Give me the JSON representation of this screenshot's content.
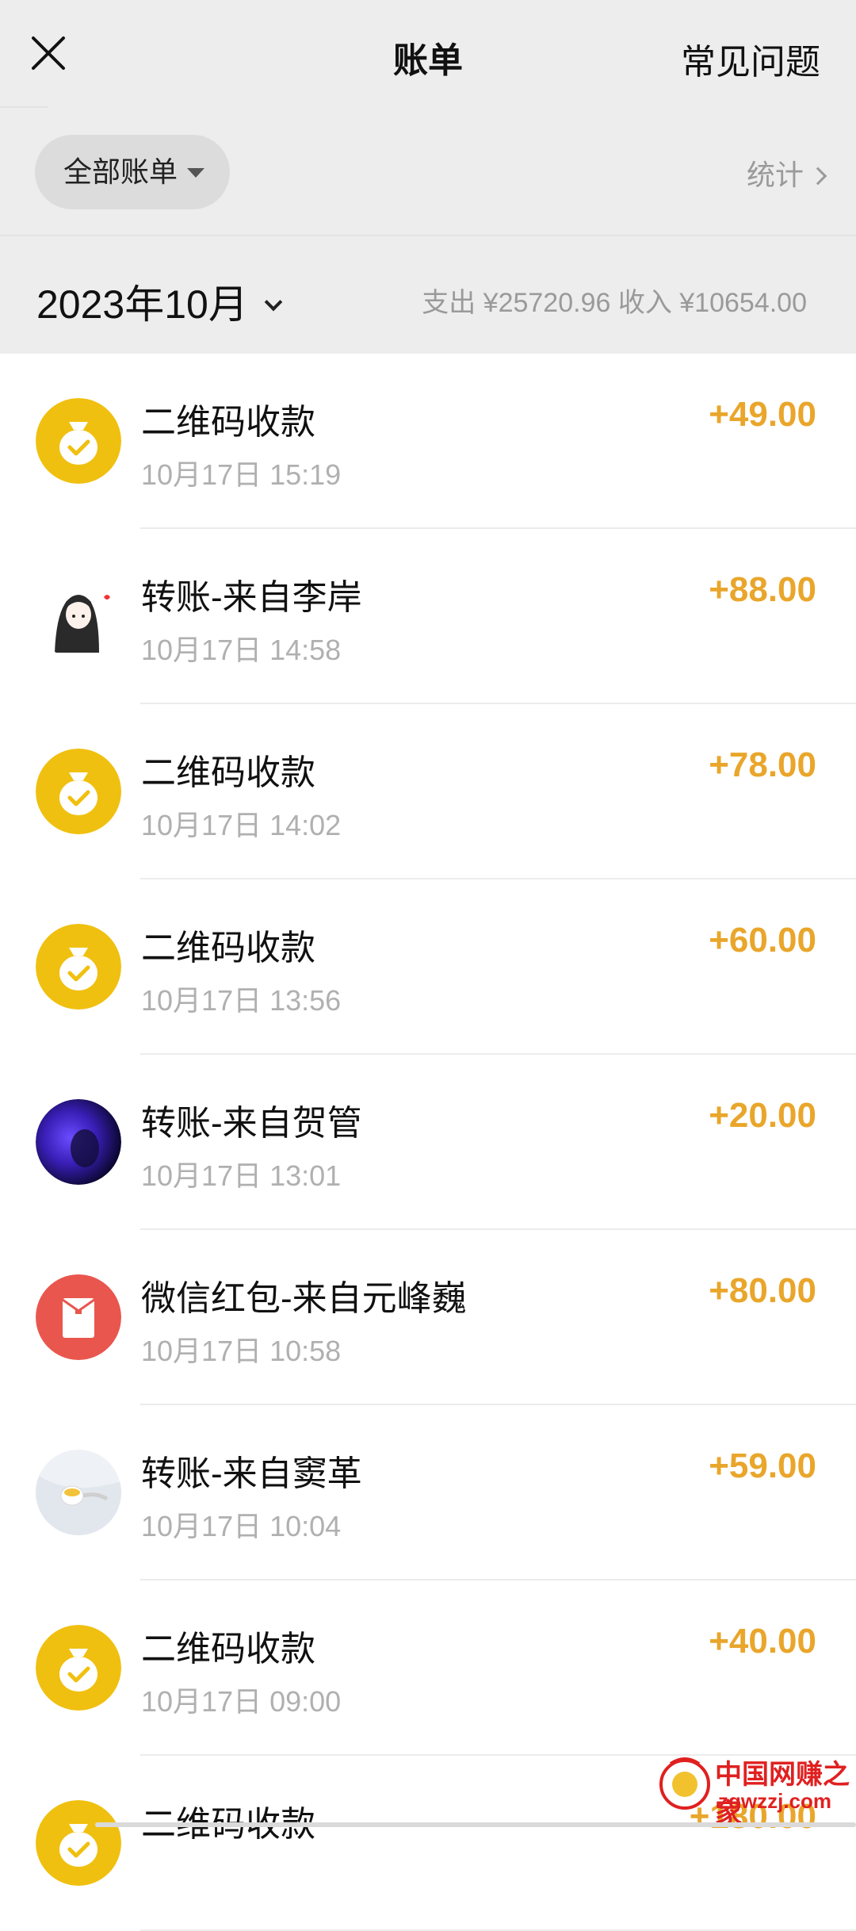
{
  "header": {
    "title": "账单",
    "close_icon": "close-icon",
    "help_label": "常见问题"
  },
  "filter": {
    "all_label": "全部账单",
    "stats_label": "统计"
  },
  "month_bar": {
    "month": "2023年10月",
    "summary": "支出 ¥25720.96 收入 ¥10654.00"
  },
  "colors": {
    "accent_amount": "#e9a62b",
    "qr_avatar": "#f0c010",
    "redpacket_avatar": "#e9564e",
    "background": "#ededed"
  },
  "transactions": [
    {
      "title": "二维码收款",
      "time": "10月17日 15:19",
      "amount": "+49.00",
      "icon": "money-bag-icon"
    },
    {
      "title": "转账-来自李岸",
      "time": "10月17日 14:58",
      "amount": "+88.00",
      "icon": "user-avatar-girl"
    },
    {
      "title": "二维码收款",
      "time": "10月17日 14:02",
      "amount": "+78.00",
      "icon": "money-bag-icon"
    },
    {
      "title": "二维码收款",
      "time": "10月17日 13:56",
      "amount": "+60.00",
      "icon": "money-bag-icon"
    },
    {
      "title": "转账-来自贺管",
      "time": "10月17日 13:01",
      "amount": "+20.00",
      "icon": "user-avatar-purple"
    },
    {
      "title": "微信红包-来自元峰巍",
      "time": "10月17日 10:58",
      "amount": "+80.00",
      "icon": "red-packet-icon"
    },
    {
      "title": "转账-来自窦革",
      "time": "10月17日 10:04",
      "amount": "+59.00",
      "icon": "user-avatar-tea"
    },
    {
      "title": "二维码收款",
      "time": "10月17日 09:00",
      "amount": "+40.00",
      "icon": "money-bag-icon"
    },
    {
      "title": "二维码收款",
      "time": "",
      "amount": "+180.00",
      "icon": "money-bag-icon"
    }
  ],
  "watermark": {
    "name": "中国网赚之家",
    "url": "zgwzzj.com"
  }
}
